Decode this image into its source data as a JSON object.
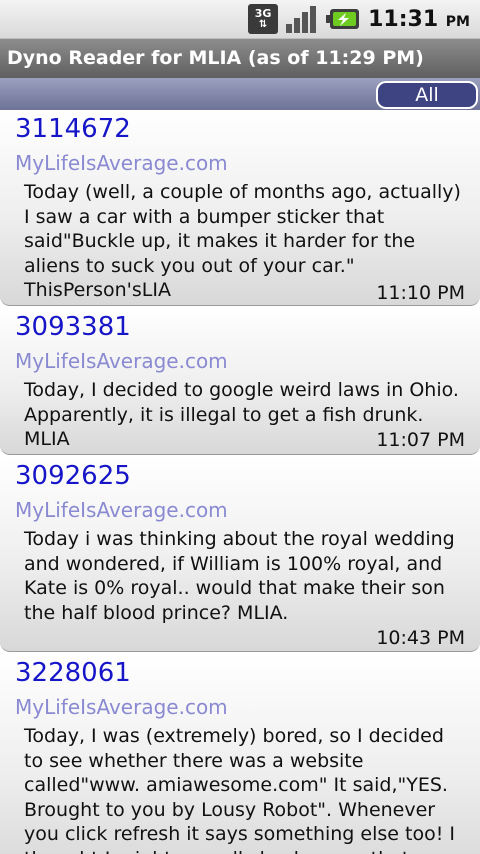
{
  "status": {
    "network": "3G",
    "time": "11:31",
    "ampm": "PM"
  },
  "app": {
    "title": "Dyno Reader for MLIA (as of 11:29 PM)",
    "filter": "All"
  },
  "posts": [
    {
      "id": "3114672",
      "source": "MyLifeIsAverage.com",
      "text": "Today (well, a couple of months ago, actually) I saw a car with a bumper sticker that said\"Buckle up, it makes it harder for the aliens to suck you out of your car.\" ThisPerson'sLIA",
      "time": "11:10 PM"
    },
    {
      "id": "3093381",
      "source": "MyLifeIsAverage.com",
      "text": "Today, I decided to google weird laws in Ohio. Apparently, it is illegal to get a fish drunk. MLIA",
      "time": "11:07 PM"
    },
    {
      "id": "3092625",
      "source": "MyLifeIsAverage.com",
      "text": "Today i was thinking about the royal wedding and wondered, if William is 100% royal, and Kate is 0% royal.. would that make their son the half blood prince? MLIA.",
      "time": "10:43 PM"
    },
    {
      "id": "3228061",
      "source": "MyLifeIsAverage.com",
      "text": "Today, I was (extremely) bored, so I decided to see whether there was a website called\"www. amiawesome.com\" It said,\"YES. Brought to you by Lousy Robot\". Whenever you click refresh it says something else too! I thought I might as well check up on that, though, so I tried\"www.",
      "time": ""
    }
  ],
  "icons": {
    "signal": "signal-bars-icon",
    "battery": "battery-charging-icon",
    "network": "3g-data-icon"
  },
  "colors": {
    "accent_blue": "#1616c8",
    "source_link": "#8a8ad2",
    "filter_button": "#3e4382"
  }
}
